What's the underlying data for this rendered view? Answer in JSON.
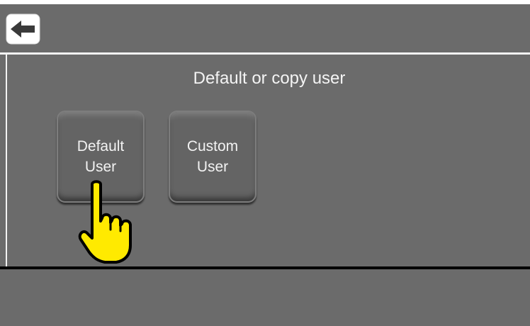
{
  "header": {
    "back_icon": "arrow-left-icon"
  },
  "page": {
    "title": "Default or copy user"
  },
  "options": [
    {
      "line1": "Default",
      "line2": "User"
    },
    {
      "line1": "Custom",
      "line2": "User"
    }
  ],
  "overlay": {
    "pointer_icon": "pointing-hand-icon"
  },
  "colors": {
    "background": "#6b6b6b",
    "divider": "#f2f2f2",
    "text": "#f4f4f4",
    "hand": "#ffea00"
  }
}
